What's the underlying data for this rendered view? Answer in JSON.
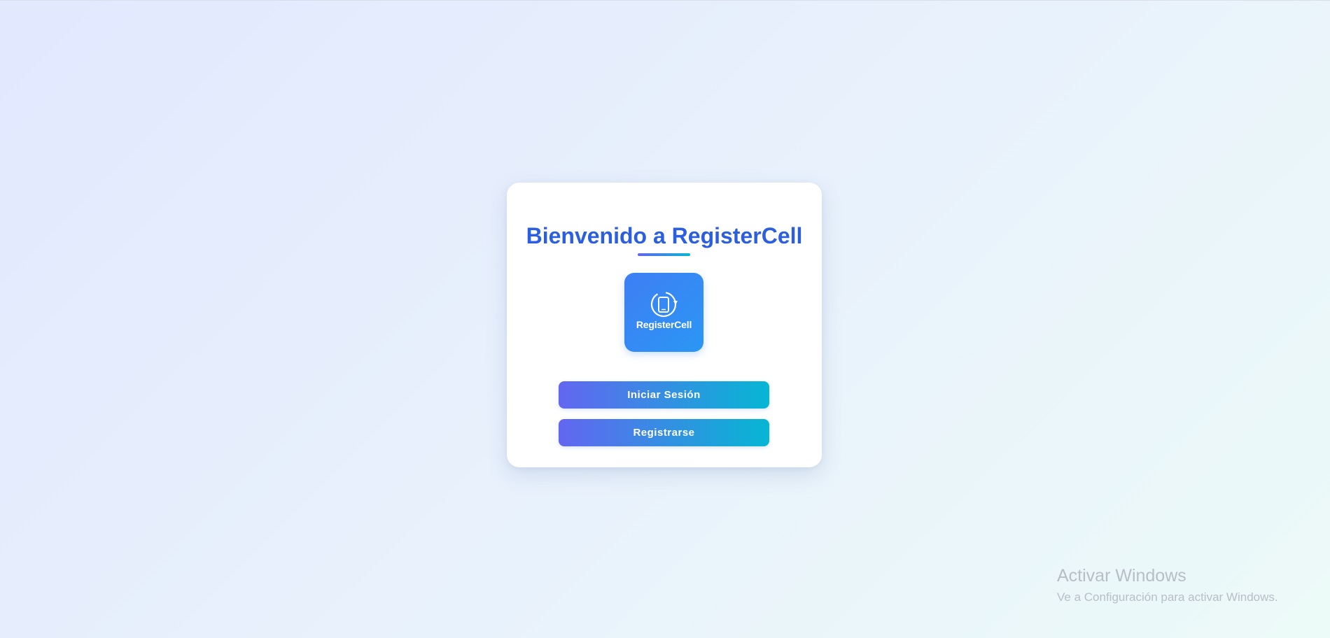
{
  "welcome": {
    "title": "Bienvenido a RegisterCell",
    "logo_text": "RegisterCell",
    "logo_icon": "phone-sync-icon"
  },
  "actions": {
    "login_label": "Iniciar Sesión",
    "register_label": "Registrarse"
  },
  "watermark": {
    "title": "Activar Windows",
    "subtitle": "Ve a Configuración para activar Windows."
  },
  "colors": {
    "title": "#2c5fe0",
    "gradient_start": "#6366f1",
    "gradient_end": "#06b6d4",
    "logo_bg": "#3e7ef5"
  }
}
